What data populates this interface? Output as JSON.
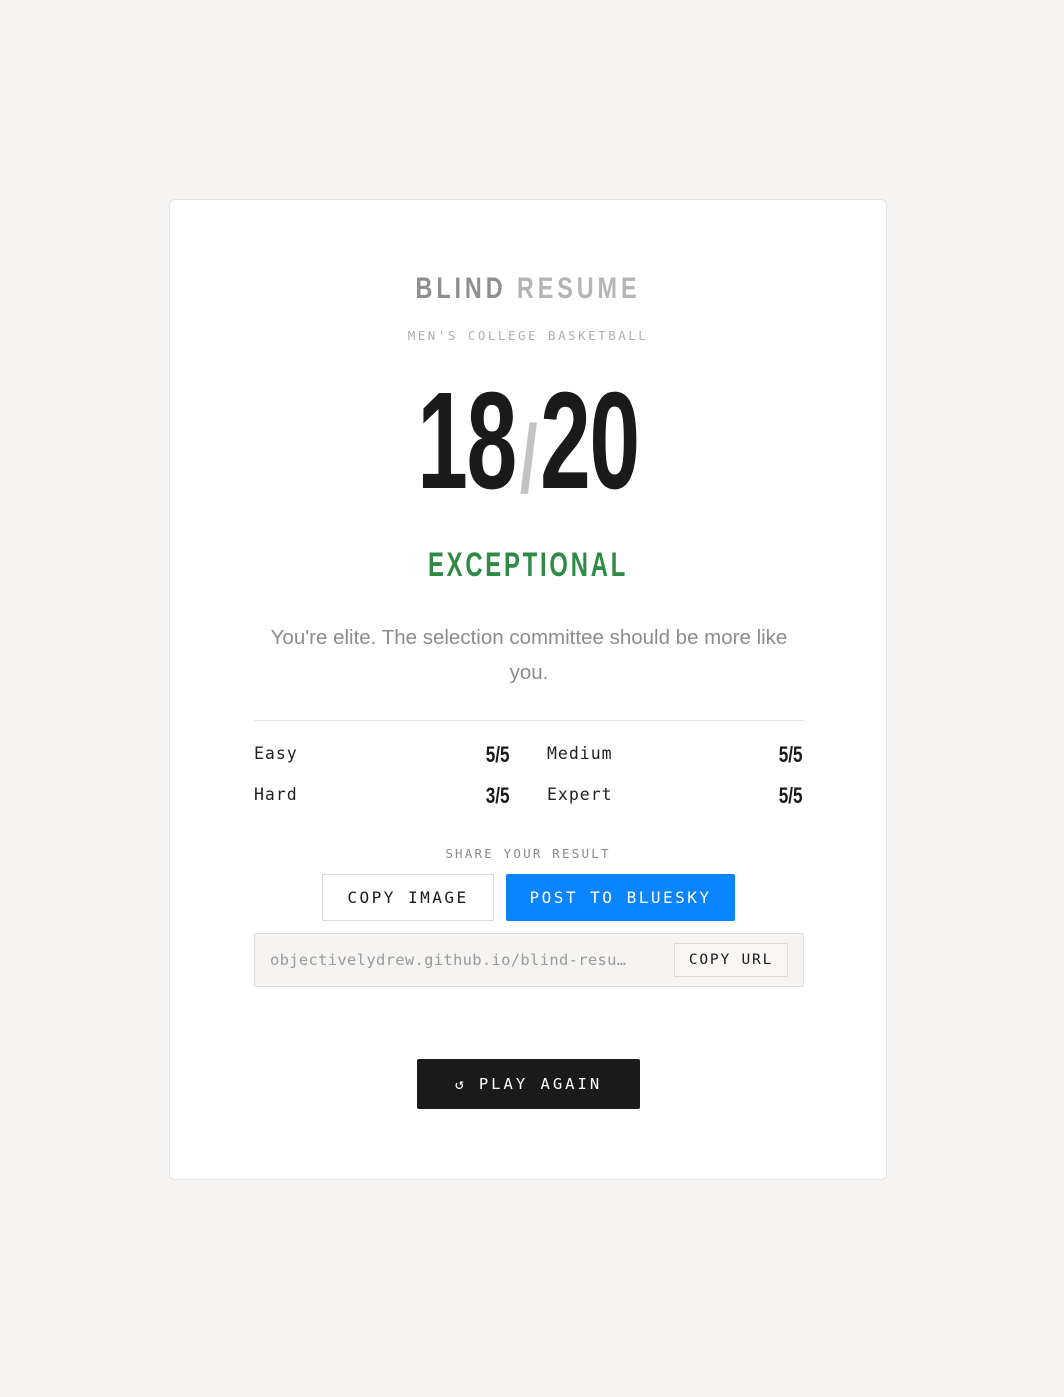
{
  "header": {
    "brand_word1": "BLIND",
    "brand_word2": "RESUME",
    "subtitle": "MEN'S COLLEGE BASKETBALL"
  },
  "score": {
    "correct": "18",
    "separator": "/",
    "total": "20"
  },
  "result": {
    "rating": "EXCEPTIONAL",
    "rating_color": "#2e8a45",
    "message": "You're elite. The selection committee should be more like you."
  },
  "breakdown": [
    {
      "label": "Easy",
      "value": "5/5"
    },
    {
      "label": "Medium",
      "value": "5/5"
    },
    {
      "label": "Hard",
      "value": "3/5"
    },
    {
      "label": "Expert",
      "value": "5/5"
    }
  ],
  "share": {
    "label": "SHARE YOUR RESULT",
    "copy_image_label": "COPY IMAGE",
    "bluesky_label": "POST TO BLUESKY",
    "bluesky_color": "#0a84ff",
    "url": "objectivelydrew.github.io/blind-resu…",
    "copy_url_label": "COPY URL"
  },
  "actions": {
    "play_again_icon": "refresh-icon",
    "play_again_label": "PLAY AGAIN"
  }
}
